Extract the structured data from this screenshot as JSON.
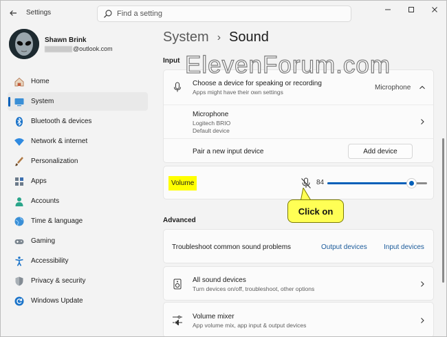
{
  "window": {
    "title": "Settings"
  },
  "search": {
    "placeholder": "Find a setting"
  },
  "user": {
    "name": "Shawn Brink",
    "email_suffix": "@outlook.com"
  },
  "nav": {
    "items": [
      {
        "label": "Home",
        "icon": "home-icon"
      },
      {
        "label": "System",
        "icon": "system-icon",
        "active": true
      },
      {
        "label": "Bluetooth & devices",
        "icon": "bluetooth-icon"
      },
      {
        "label": "Network & internet",
        "icon": "wifi-icon"
      },
      {
        "label": "Personalization",
        "icon": "brush-icon"
      },
      {
        "label": "Apps",
        "icon": "apps-icon"
      },
      {
        "label": "Accounts",
        "icon": "accounts-icon"
      },
      {
        "label": "Time & language",
        "icon": "globe-icon"
      },
      {
        "label": "Gaming",
        "icon": "gamepad-icon"
      },
      {
        "label": "Accessibility",
        "icon": "accessibility-icon"
      },
      {
        "label": "Privacy & security",
        "icon": "shield-icon"
      },
      {
        "label": "Windows Update",
        "icon": "update-icon"
      }
    ]
  },
  "breadcrumb": {
    "parent": "System",
    "separator": "›",
    "current": "Sound"
  },
  "watermark": "ElevenForum.com",
  "input": {
    "section_label": "Input",
    "choose_device": {
      "title": "Choose a device for speaking or recording",
      "subtitle": "Apps might have their own settings",
      "value": "Microphone"
    },
    "microphone": {
      "title": "Microphone",
      "subtitle1": "Logitech BRIO",
      "subtitle2": "Default device"
    },
    "pair": {
      "title": "Pair a new input device",
      "button": "Add device"
    },
    "volume": {
      "label": "Volume",
      "value": "84",
      "level_percent": 84,
      "muted_icon": "mic-muted-icon"
    }
  },
  "callout": {
    "text": "Click on"
  },
  "advanced": {
    "section_label": "Advanced",
    "troubleshoot": {
      "title": "Troubleshoot common sound problems",
      "link1": "Output devices",
      "link2": "Input devices"
    },
    "all_sound_devices": {
      "title": "All sound devices",
      "subtitle": "Turn devices on/off, troubleshoot, other options"
    },
    "volume_mixer": {
      "title": "Volume mixer",
      "subtitle": "App volume mix, app input & output devices"
    }
  },
  "colors": {
    "accent": "#005fb8",
    "highlight": "#ffff00",
    "callout": "#ffff55"
  }
}
